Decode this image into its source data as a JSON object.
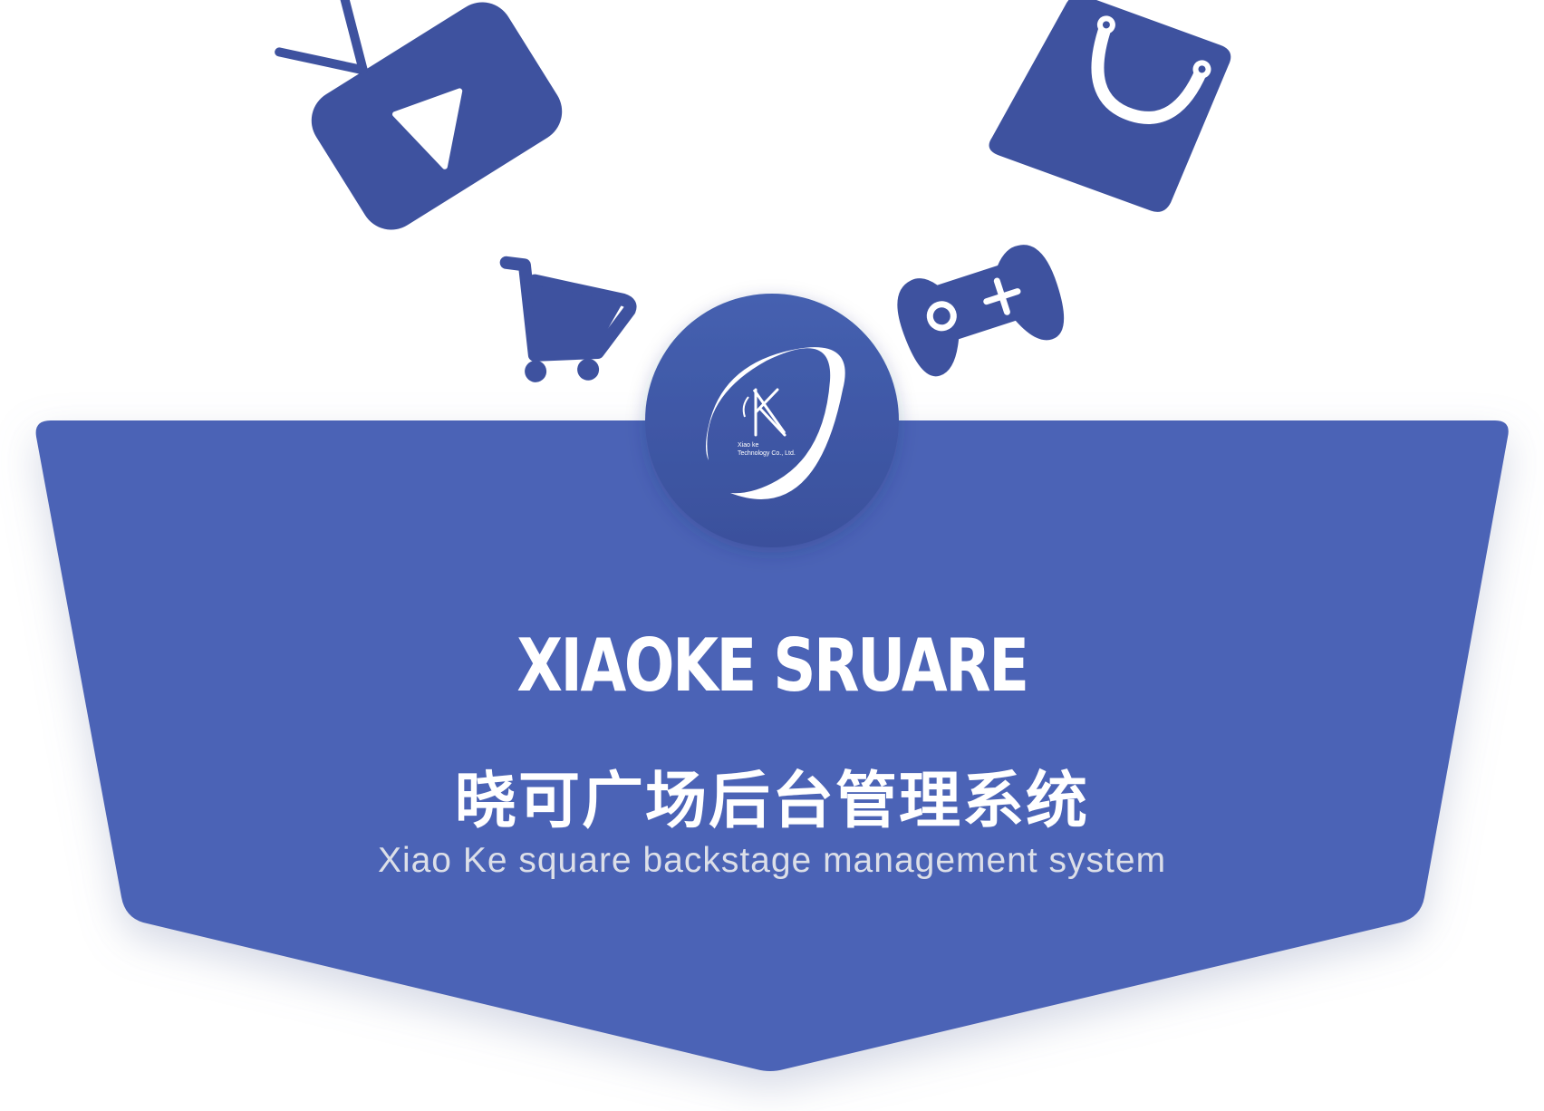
{
  "brand": {
    "title_en": "XIAOKE SRUARE",
    "title_cn": "晓可广场后台管理系统",
    "subtitle": "Xiao Ke square backstage management system",
    "logo_caption_line1": "Xiao ke",
    "logo_caption_line2": "Technology Co., Ltd."
  },
  "colors": {
    "background": "#ffffff",
    "banner": "#4c63b6",
    "icons": "#3e529f",
    "logo_circle": "#3f56a5",
    "text_primary": "#ffffff",
    "text_secondary": "#dcdfe8"
  },
  "icons": [
    "tv-play-icon",
    "shopping-bag-icon",
    "shopping-cart-icon",
    "gamepad-icon",
    "company-logo"
  ]
}
